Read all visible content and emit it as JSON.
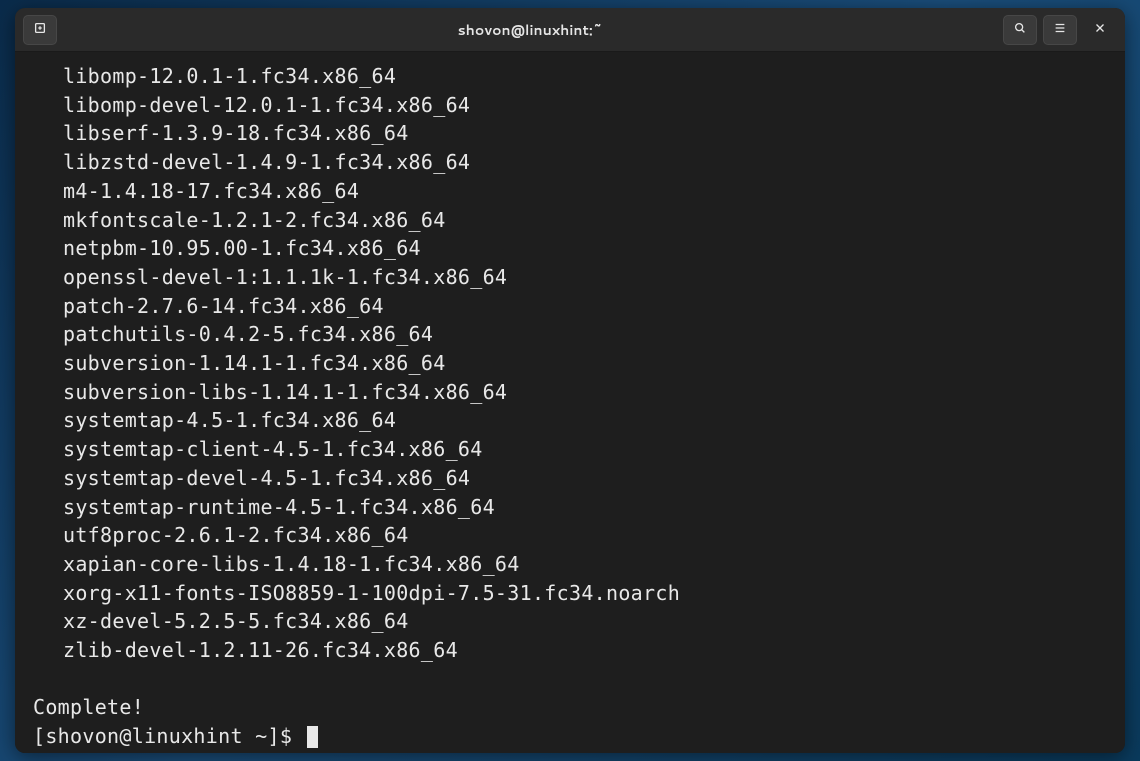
{
  "titlebar": {
    "title": "shovon@linuxhint:~"
  },
  "terminal": {
    "packages": [
      "libomp-12.0.1-1.fc34.x86_64",
      "libomp-devel-12.0.1-1.fc34.x86_64",
      "libserf-1.3.9-18.fc34.x86_64",
      "libzstd-devel-1.4.9-1.fc34.x86_64",
      "m4-1.4.18-17.fc34.x86_64",
      "mkfontscale-1.2.1-2.fc34.x86_64",
      "netpbm-10.95.00-1.fc34.x86_64",
      "openssl-devel-1:1.1.1k-1.fc34.x86_64",
      "patch-2.7.6-14.fc34.x86_64",
      "patchutils-0.4.2-5.fc34.x86_64",
      "subversion-1.14.1-1.fc34.x86_64",
      "subversion-libs-1.14.1-1.fc34.x86_64",
      "systemtap-4.5-1.fc34.x86_64",
      "systemtap-client-4.5-1.fc34.x86_64",
      "systemtap-devel-4.5-1.fc34.x86_64",
      "systemtap-runtime-4.5-1.fc34.x86_64",
      "utf8proc-2.6.1-2.fc34.x86_64",
      "xapian-core-libs-1.4.18-1.fc34.x86_64",
      "xorg-x11-fonts-ISO8859-1-100dpi-7.5-31.fc34.noarch",
      "xz-devel-5.2.5-5.fc34.x86_64",
      "zlib-devel-1.2.11-26.fc34.x86_64"
    ],
    "complete": "Complete!",
    "prompt": "[shovon@linuxhint ~]$ "
  }
}
